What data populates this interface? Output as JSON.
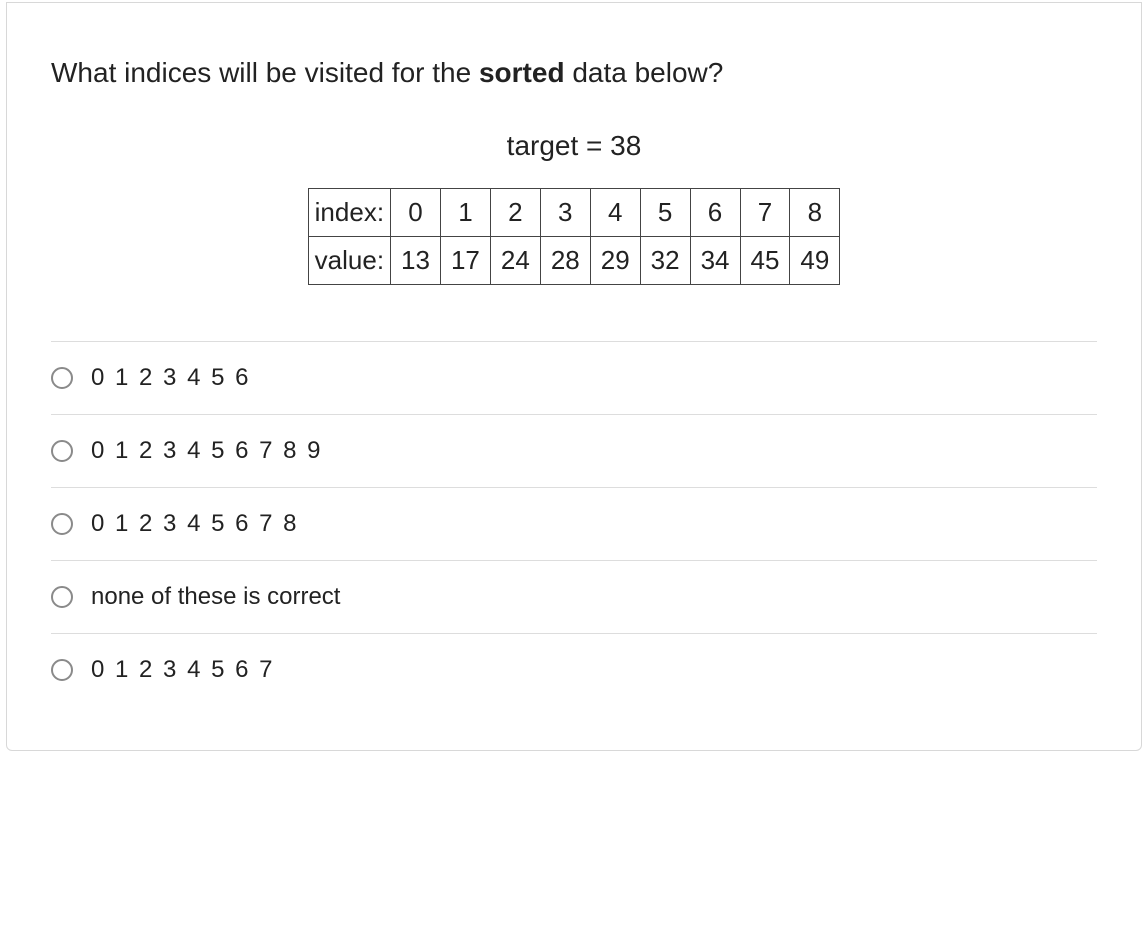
{
  "question": {
    "prefix": "What indices will be visited for the ",
    "bold": "sorted",
    "suffix": " data below?"
  },
  "target_line": "target = 38",
  "table": {
    "index_label": "index:",
    "value_label": "value:",
    "indices": [
      "0",
      "1",
      "2",
      "3",
      "4",
      "5",
      "6",
      "7",
      "8"
    ],
    "values": [
      "13",
      "17",
      "24",
      "28",
      "29",
      "32",
      "34",
      "45",
      "49"
    ]
  },
  "options": [
    {
      "label": "0 1 2 3 4 5 6",
      "spaced": true
    },
    {
      "label": "0 1 2 3 4 5 6 7 8 9",
      "spaced": true
    },
    {
      "label": "0 1 2 3 4 5 6 7 8",
      "spaced": true
    },
    {
      "label": "none of these is correct",
      "spaced": false
    },
    {
      "label": "0 1 2 3 4 5 6 7",
      "spaced": true
    }
  ]
}
